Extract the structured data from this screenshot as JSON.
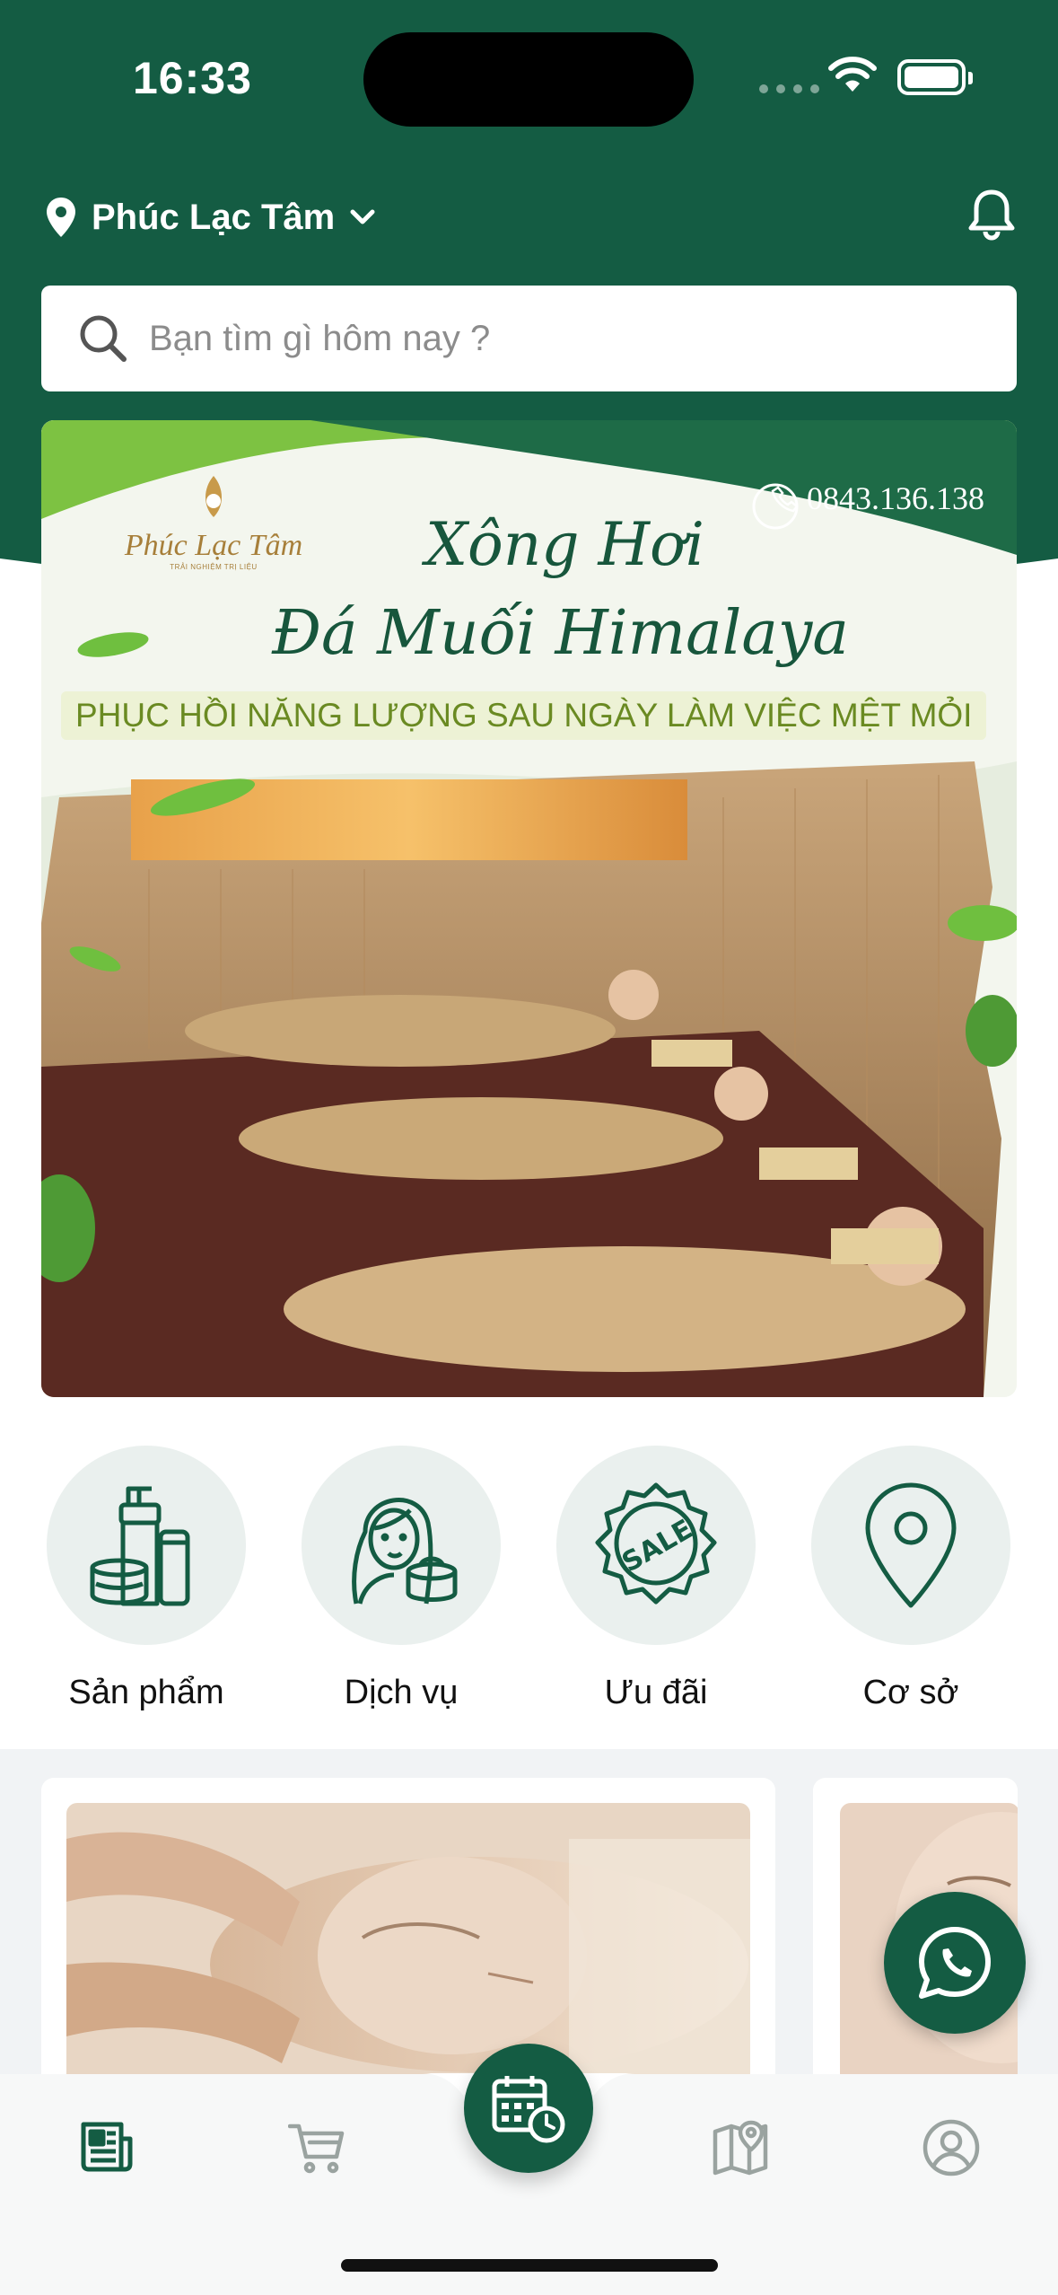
{
  "status": {
    "time": "16:33"
  },
  "header": {
    "location_name": "Phúc Lạc Tâm"
  },
  "search": {
    "placeholder": "Bạn tìm gì hôm nay ?"
  },
  "banner": {
    "phone": "0843.136.138",
    "brand_name": "Phúc Lạc Tâm",
    "brand_tagline": "TRẢI NGHIỆM TRỊ LIỆU",
    "title_line1": "Xông Hơi",
    "title_line2": "Đá Muối Himalaya",
    "slogan": "PHỤC HỒI NĂNG LƯỢNG SAU NGÀY LÀM VIỆC MỆT MỎI"
  },
  "categories": [
    {
      "label": "Sản phẩm",
      "icon": "cosmetics-icon"
    },
    {
      "label": "Dịch vụ",
      "icon": "beauty-service-icon"
    },
    {
      "label": "Ưu đãi",
      "icon": "sale-badge-icon"
    },
    {
      "label": "Cơ sở",
      "icon": "map-pin-icon"
    }
  ],
  "tabbar": {
    "items": [
      "news-icon",
      "cart-icon",
      "booking-calendar-icon",
      "map-icon",
      "profile-icon"
    ]
  },
  "colors": {
    "primary": "#145c43",
    "circle_bg": "#eaf0ee",
    "banner_leaf": "#7dc242"
  }
}
